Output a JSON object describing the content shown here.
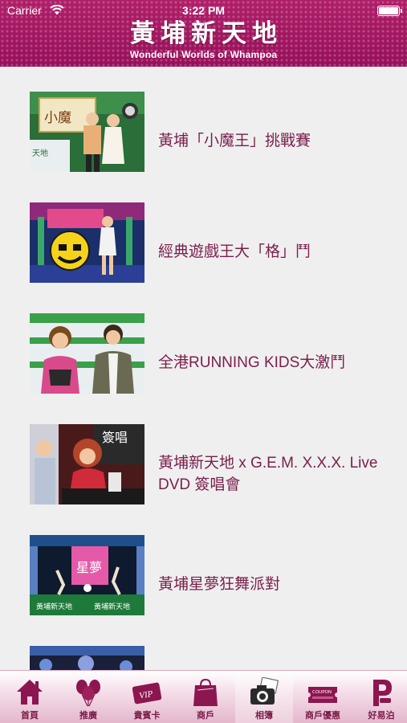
{
  "status_bar": {
    "carrier": "Carrier",
    "time": "3:22 PM"
  },
  "header": {
    "title": "黃埔新天地",
    "subtitle": "Wonderful Worlds of Whampoa"
  },
  "events": [
    {
      "title": "黃埔「小魔王」挑戰賽"
    },
    {
      "title": "經典遊戲王大「格」鬥"
    },
    {
      "title": "全港RUNNING KIDS大激鬥"
    },
    {
      "title": "黃埔新天地 x G.E.M. X.X.X. Live DVD 簽唱會"
    },
    {
      "title": "黃埔星夢狂舞派對"
    },
    {
      "title": ""
    }
  ],
  "tabs": [
    {
      "label": "首頁",
      "icon": "home-icon"
    },
    {
      "label": "推廣",
      "icon": "balloons-icon"
    },
    {
      "label": "貴賓卡",
      "icon": "vip-card-icon"
    },
    {
      "label": "商戶",
      "icon": "shopping-bag-icon"
    },
    {
      "label": "相簿",
      "icon": "camera-icon"
    },
    {
      "label": "商戶優惠",
      "icon": "coupon-icon"
    },
    {
      "label": "好易泊",
      "icon": "parking-icon"
    }
  ],
  "colors": {
    "brand": "#a3155f",
    "title_text": "#7a1f4b",
    "tab_text": "#7a1a48",
    "background": "#efeff0"
  }
}
